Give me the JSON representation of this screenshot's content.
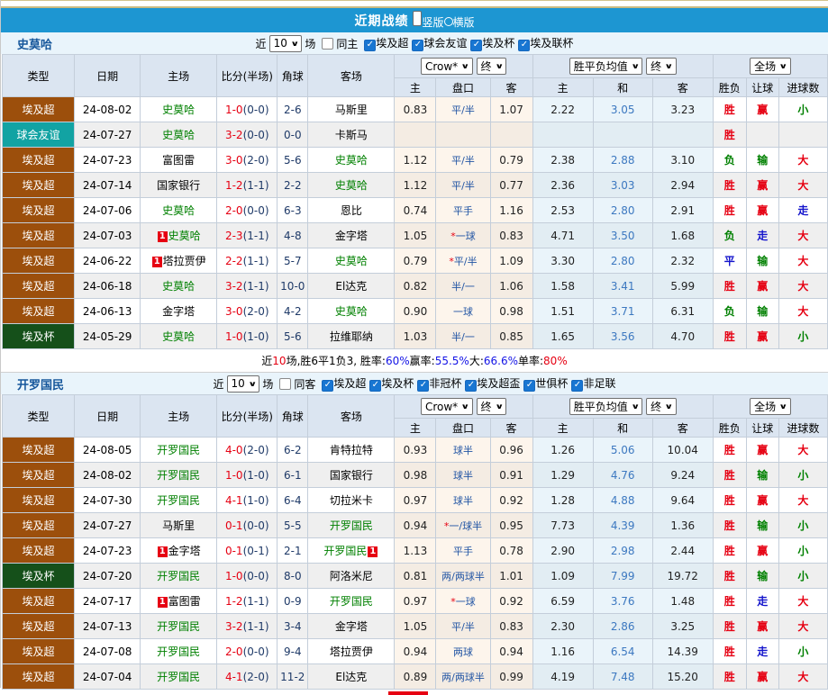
{
  "page": {
    "title": "近期战绩",
    "radio_options": [
      {
        "label": "竖版",
        "selected": true
      },
      {
        "label": "横版",
        "selected": false
      }
    ]
  },
  "colors": {
    "header_bar": "#1D96D2",
    "filter_bg": "#E9F4FB",
    "team_name_blue": "#15569B",
    "league_colors": {
      "埃及超": "#9C4F0C",
      "球会友谊": "#12A3A3",
      "埃及杯": "#15501A"
    },
    "score_red": "#E60012",
    "half_navy": "#1F3A68",
    "handicap_blue": "#2255A4",
    "avg_draw_blue": "#3C78C0",
    "result_colors": {
      "胜": "red",
      "负": "green",
      "平": "blue",
      "赢": "red",
      "输": "green",
      "走": "blue",
      "大": "red",
      "小": "green"
    }
  },
  "table_header": {
    "left_cols": [
      "类型",
      "日期",
      "主场",
      "比分(半场)",
      "角球",
      "客场"
    ],
    "odds_source_select": "Crow*",
    "odds_final_select": "终",
    "avg_source_select": "胜平负均值",
    "avg_final_select": "终",
    "scope_select": "全场",
    "sub_cols": [
      "主",
      "盘口",
      "客",
      "主",
      "和",
      "客",
      "胜负",
      "让球",
      "进球数"
    ]
  },
  "sections": [
    {
      "team": "史莫哈",
      "filter": {
        "near": "近",
        "count": "10",
        "unit": "场",
        "same": "同主",
        "leagues": [
          "埃及超",
          "球会友谊",
          "埃及杯",
          "埃及联杯"
        ]
      },
      "rows": [
        {
          "type": "埃及超",
          "date": "24-08-02",
          "home": "史莫哈",
          "home_card": false,
          "score": "1-0",
          "half": "(0-0)",
          "corner": "2-6",
          "away": "马斯里",
          "away_card": false,
          "crow_home": "0.83",
          "handicap": "平/半",
          "crow_away": "1.07",
          "avg_home": "2.22",
          "avg_draw": "3.05",
          "avg_away": "3.23",
          "result": "胜",
          "handicap_result": "赢",
          "goals": "小"
        },
        {
          "type": "球会友谊",
          "date": "24-07-27",
          "home": "史莫哈",
          "home_card": false,
          "score": "3-2",
          "half": "(0-0)",
          "corner": "0-0",
          "away": "卡斯马",
          "away_card": false,
          "crow_home": "",
          "handicap": "",
          "crow_away": "",
          "avg_home": "",
          "avg_draw": "",
          "avg_away": "",
          "result": "胜",
          "handicap_result": "",
          "goals": ""
        },
        {
          "type": "埃及超",
          "date": "24-07-23",
          "home": "富图雷",
          "home_card": false,
          "score": "3-0",
          "half": "(2-0)",
          "corner": "5-6",
          "away": "史莫哈",
          "away_card": false,
          "crow_home": "1.12",
          "handicap": "平/半",
          "crow_away": "0.79",
          "avg_home": "2.38",
          "avg_draw": "2.88",
          "avg_away": "3.10",
          "result": "负",
          "handicap_result": "输",
          "goals": "大"
        },
        {
          "type": "埃及超",
          "date": "24-07-14",
          "home": "国家银行",
          "home_card": false,
          "score": "1-2",
          "half": "(1-1)",
          "corner": "2-2",
          "away": "史莫哈",
          "away_card": false,
          "crow_home": "1.12",
          "handicap": "平/半",
          "crow_away": "0.77",
          "avg_home": "2.36",
          "avg_draw": "3.03",
          "avg_away": "2.94",
          "result": "胜",
          "handicap_result": "赢",
          "goals": "大"
        },
        {
          "type": "埃及超",
          "date": "24-07-06",
          "home": "史莫哈",
          "home_card": false,
          "score": "2-0",
          "half": "(0-0)",
          "corner": "6-3",
          "away": "恩比",
          "away_card": false,
          "crow_home": "0.74",
          "handicap": "平手",
          "crow_away": "1.16",
          "avg_home": "2.53",
          "avg_draw": "2.80",
          "avg_away": "2.91",
          "result": "胜",
          "handicap_result": "赢",
          "goals": "走"
        },
        {
          "type": "埃及超",
          "date": "24-07-03",
          "home": "史莫哈",
          "home_card": true,
          "score": "2-3",
          "half": "(1-1)",
          "corner": "4-8",
          "away": "金字塔",
          "away_card": false,
          "crow_home": "1.05",
          "handicap": "*一球",
          "crow_away": "0.83",
          "avg_home": "4.71",
          "avg_draw": "3.50",
          "avg_away": "1.68",
          "result": "负",
          "handicap_result": "走",
          "goals": "大"
        },
        {
          "type": "埃及超",
          "date": "24-06-22",
          "home": "塔拉贾伊",
          "home_card": true,
          "score": "2-2",
          "half": "(1-1)",
          "corner": "5-7",
          "away": "史莫哈",
          "away_card": false,
          "crow_home": "0.79",
          "handicap": "*平/半",
          "crow_away": "1.09",
          "avg_home": "3.30",
          "avg_draw": "2.80",
          "avg_away": "2.32",
          "result": "平",
          "handicap_result": "输",
          "goals": "大"
        },
        {
          "type": "埃及超",
          "date": "24-06-18",
          "home": "史莫哈",
          "home_card": false,
          "score": "3-2",
          "half": "(1-1)",
          "corner": "10-0",
          "away": "El达克",
          "away_card": false,
          "crow_home": "0.82",
          "handicap": "半/一",
          "crow_away": "1.06",
          "avg_home": "1.58",
          "avg_draw": "3.41",
          "avg_away": "5.99",
          "result": "胜",
          "handicap_result": "赢",
          "goals": "大"
        },
        {
          "type": "埃及超",
          "date": "24-06-13",
          "home": "金字塔",
          "home_card": false,
          "score": "3-0",
          "half": "(2-0)",
          "corner": "4-2",
          "away": "史莫哈",
          "away_card": false,
          "crow_home": "0.90",
          "handicap": "一球",
          "crow_away": "0.98",
          "avg_home": "1.51",
          "avg_draw": "3.71",
          "avg_away": "6.31",
          "result": "负",
          "handicap_result": "输",
          "goals": "大"
        },
        {
          "type": "埃及杯",
          "date": "24-05-29",
          "home": "史莫哈",
          "home_card": false,
          "score": "1-0",
          "half": "(1-0)",
          "corner": "5-6",
          "away": "拉维耶纳",
          "away_card": false,
          "crow_home": "1.03",
          "handicap": "半/一",
          "crow_away": "0.85",
          "avg_home": "1.65",
          "avg_draw": "3.56",
          "avg_away": "4.70",
          "result": "胜",
          "handicap_result": "赢",
          "goals": "小"
        }
      ],
      "summary_parts": [
        {
          "t": "近",
          "c": "k"
        },
        {
          "t": "10",
          "c": "r"
        },
        {
          "t": "场,胜6平1负3, 胜率:",
          "c": "k"
        },
        {
          "t": "60%",
          "c": "b"
        },
        {
          "t": " 赢率:",
          "c": "k"
        },
        {
          "t": "55.5%",
          "c": "b"
        },
        {
          "t": " 大:",
          "c": "k"
        },
        {
          "t": "66.6%",
          "c": "b"
        },
        {
          "t": " 单率:",
          "c": "k"
        },
        {
          "t": "80%",
          "c": "r"
        }
      ]
    },
    {
      "team": "开罗国民",
      "filter": {
        "near": "近",
        "count": "10",
        "unit": "场",
        "same": "同客",
        "leagues": [
          "埃及超",
          "埃及杯",
          "非冠杯",
          "埃及超盃",
          "世俱杯",
          "非足联"
        ]
      },
      "rows": [
        {
          "type": "埃及超",
          "date": "24-08-05",
          "home": "开罗国民",
          "home_card": false,
          "score": "4-0",
          "half": "(2-0)",
          "corner": "6-2",
          "away": "肯特拉特",
          "away_card": false,
          "crow_home": "0.93",
          "handicap": "球半",
          "crow_away": "0.96",
          "avg_home": "1.26",
          "avg_draw": "5.06",
          "avg_away": "10.04",
          "result": "胜",
          "handicap_result": "赢",
          "goals": "大"
        },
        {
          "type": "埃及超",
          "date": "24-08-02",
          "home": "开罗国民",
          "home_card": false,
          "score": "1-0",
          "half": "(1-0)",
          "corner": "6-1",
          "away": "国家银行",
          "away_card": false,
          "crow_home": "0.98",
          "handicap": "球半",
          "crow_away": "0.91",
          "avg_home": "1.29",
          "avg_draw": "4.76",
          "avg_away": "9.24",
          "result": "胜",
          "handicap_result": "输",
          "goals": "小"
        },
        {
          "type": "埃及超",
          "date": "24-07-30",
          "home": "开罗国民",
          "home_card": false,
          "score": "4-1",
          "half": "(1-0)",
          "corner": "6-4",
          "away": "切拉米卡",
          "away_card": false,
          "crow_home": "0.97",
          "handicap": "球半",
          "crow_away": "0.92",
          "avg_home": "1.28",
          "avg_draw": "4.88",
          "avg_away": "9.64",
          "result": "胜",
          "handicap_result": "赢",
          "goals": "大"
        },
        {
          "type": "埃及超",
          "date": "24-07-27",
          "home": "马斯里",
          "home_card": false,
          "score": "0-1",
          "half": "(0-0)",
          "corner": "5-5",
          "away": "开罗国民",
          "away_card": false,
          "crow_home": "0.94",
          "handicap": "*一/球半",
          "crow_away": "0.95",
          "avg_home": "7.73",
          "avg_draw": "4.39",
          "avg_away": "1.36",
          "result": "胜",
          "handicap_result": "输",
          "goals": "小"
        },
        {
          "type": "埃及超",
          "date": "24-07-23",
          "home": "金字塔",
          "home_card": true,
          "score": "0-1",
          "half": "(0-1)",
          "corner": "2-1",
          "away": "开罗国民",
          "away_card": true,
          "crow_home": "1.13",
          "handicap": "平手",
          "crow_away": "0.78",
          "avg_home": "2.90",
          "avg_draw": "2.98",
          "avg_away": "2.44",
          "result": "胜",
          "handicap_result": "赢",
          "goals": "小"
        },
        {
          "type": "埃及杯",
          "date": "24-07-20",
          "home": "开罗国民",
          "home_card": false,
          "score": "1-0",
          "half": "(0-0)",
          "corner": "8-0",
          "away": "阿洛米尼",
          "away_card": false,
          "crow_home": "0.81",
          "handicap": "两/两球半",
          "crow_away": "1.01",
          "avg_home": "1.09",
          "avg_draw": "7.99",
          "avg_away": "19.72",
          "result": "胜",
          "handicap_result": "输",
          "goals": "小"
        },
        {
          "type": "埃及超",
          "date": "24-07-17",
          "home": "富图雷",
          "home_card": true,
          "score": "1-2",
          "half": "(1-1)",
          "corner": "0-9",
          "away": "开罗国民",
          "away_card": false,
          "crow_home": "0.97",
          "handicap": "*一球",
          "crow_away": "0.92",
          "avg_home": "6.59",
          "avg_draw": "3.76",
          "avg_away": "1.48",
          "result": "胜",
          "handicap_result": "走",
          "goals": "大"
        },
        {
          "type": "埃及超",
          "date": "24-07-13",
          "home": "开罗国民",
          "home_card": false,
          "score": "3-2",
          "half": "(1-1)",
          "corner": "3-4",
          "away": "金字塔",
          "away_card": false,
          "crow_home": "1.05",
          "handicap": "平/半",
          "crow_away": "0.83",
          "avg_home": "2.30",
          "avg_draw": "2.86",
          "avg_away": "3.25",
          "result": "胜",
          "handicap_result": "赢",
          "goals": "大"
        },
        {
          "type": "埃及超",
          "date": "24-07-08",
          "home": "开罗国民",
          "home_card": false,
          "score": "2-0",
          "half": "(0-0)",
          "corner": "9-4",
          "away": "塔拉贾伊",
          "away_card": false,
          "crow_home": "0.94",
          "handicap": "两球",
          "crow_away": "0.94",
          "avg_home": "1.16",
          "avg_draw": "6.54",
          "avg_away": "14.39",
          "result": "胜",
          "handicap_result": "走",
          "goals": "小"
        },
        {
          "type": "埃及超",
          "date": "24-07-04",
          "home": "开罗国民",
          "home_card": false,
          "score": "4-1",
          "half": "(2-0)",
          "corner": "11-2",
          "away": "El达克",
          "away_card": false,
          "crow_home": "0.89",
          "handicap": "两/两球半",
          "crow_away": "0.99",
          "avg_home": "4.19",
          "avg_draw": "7.48",
          "avg_away": "15.20",
          "result": "胜",
          "handicap_result": "赢",
          "goals": "大"
        }
      ],
      "partial_marker": true
    }
  ]
}
